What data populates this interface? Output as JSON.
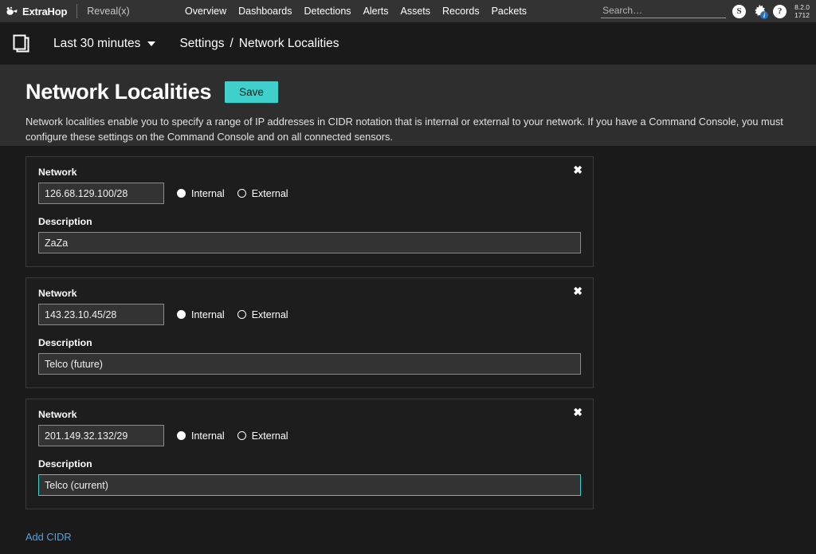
{
  "topnav": {
    "brand": "ExtraHop",
    "product": "Reveal(x)",
    "links": [
      "Overview",
      "Dashboards",
      "Detections",
      "Alerts",
      "Assets",
      "Records",
      "Packets"
    ],
    "search_placeholder": "Search…",
    "search_value": "",
    "support_icon_label": "S",
    "help_icon_label": "?",
    "gear_badge_label": "i",
    "version": "8.2.0",
    "build": "1712"
  },
  "subheader": {
    "panes_icon": "panes-icon",
    "time_range": "Last 30 minutes",
    "breadcrumb": {
      "parent": "Settings",
      "separator": "/",
      "current": "Network Localities"
    }
  },
  "page": {
    "title": "Network Localities",
    "save_label": "Save",
    "description": "Network localities enable you to specify a range of IP addresses in CIDR notation that is internal or external to your network. If you have a Command Console, you must configure these settings on the Command Console and on all connected sensors.",
    "add_cidr_label": "Add CIDR"
  },
  "labels": {
    "network": "Network",
    "description": "Description",
    "internal": "Internal",
    "external": "External",
    "close": "✖"
  },
  "colors": {
    "accent_teal": "#3fd0cb",
    "link_blue": "#4da3e8",
    "badge_blue": "#2a6ebb",
    "topnav_bg": "#333333",
    "header_bg": "#2e2e2e",
    "body_bg": "#1a1a1a",
    "card_bg": "#1d1d1d",
    "input_bg": "#333333"
  },
  "localities": [
    {
      "network": "126.68.129.100/28",
      "scope": "Internal",
      "description": "ZaZa",
      "description_focused": false
    },
    {
      "network": "143.23.10.45/28",
      "scope": "Internal",
      "description": "Telco (future)",
      "description_focused": false
    },
    {
      "network": "201.149.32.132/29",
      "scope": "Internal",
      "description": "Telco (current)",
      "description_focused": true
    }
  ]
}
